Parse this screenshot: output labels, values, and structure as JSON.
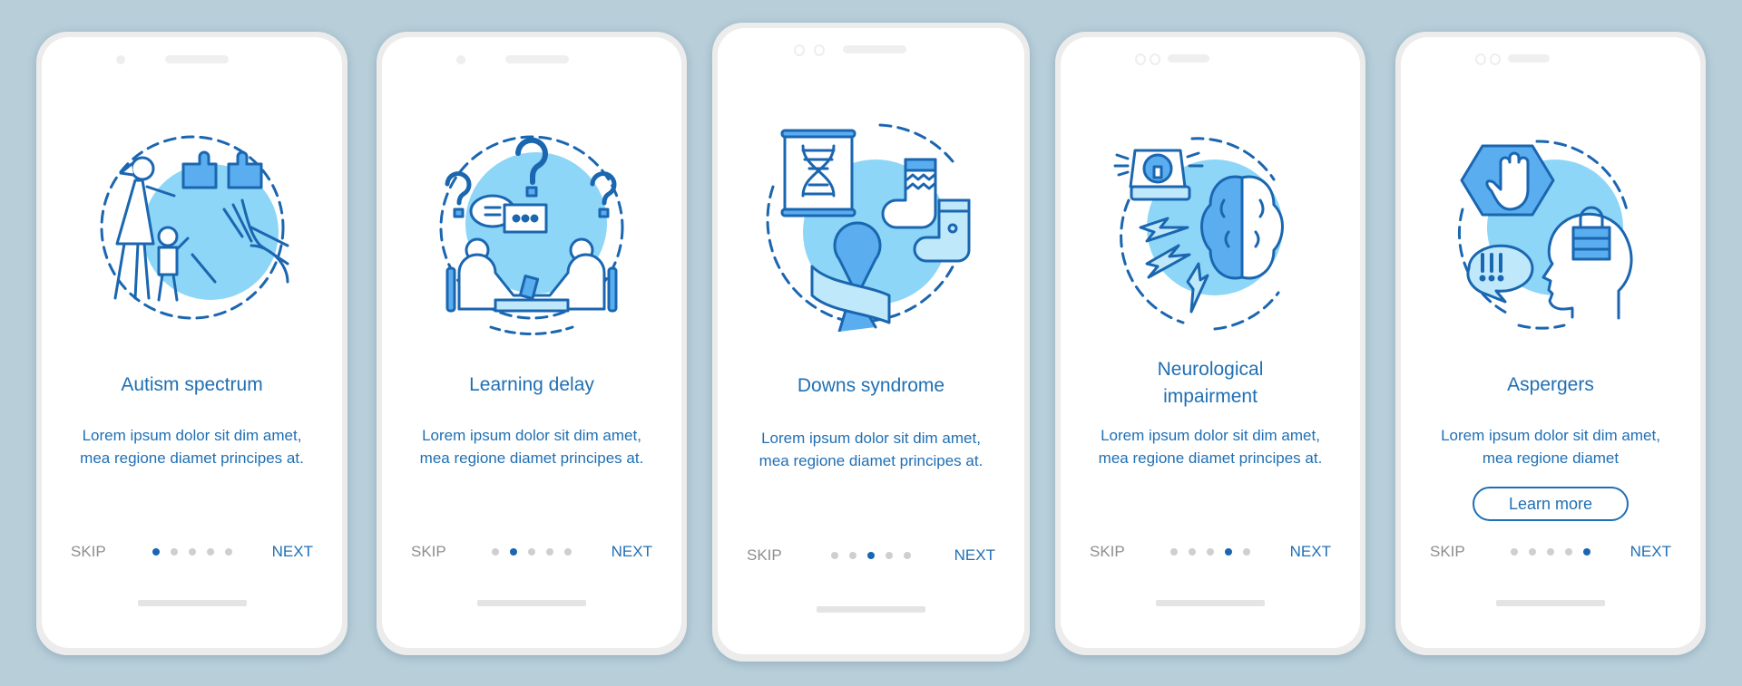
{
  "colors": {
    "background": "#b8cfda",
    "accent": "#1f6fb4",
    "active_dot": "#1a66b0",
    "inactive_dot": "#cfcfcf",
    "skip_text": "#8e8e8e",
    "illustration_fill": "#8dd6f7",
    "illustration_stroke": "#1a66b0"
  },
  "screens": [
    {
      "icon": "autism-family-icon",
      "title": "Autism spectrum",
      "description": "Lorem ipsum dolor sit dim amet, mea regione diamet principes at.",
      "skip_label": "SKIP",
      "next_label": "NEXT",
      "active_page": 1,
      "total_pages": 5
    },
    {
      "icon": "learning-conversation-icon",
      "title": "Learning delay",
      "description": "Lorem ipsum dolor sit dim amet, mea regione diamet principes at.",
      "skip_label": "SKIP",
      "next_label": "NEXT",
      "active_page": 2,
      "total_pages": 5
    },
    {
      "icon": "dna-socks-ribbon-icon",
      "title": "Downs syndrome",
      "description": "Lorem ipsum dolor sit dim amet, mea regione diamet principes at.",
      "skip_label": "SKIP",
      "next_label": "NEXT",
      "active_page": 3,
      "total_pages": 5
    },
    {
      "icon": "siren-brain-icon",
      "title": "Neurological impairment",
      "title_lines": [
        "Neurological",
        "impairment"
      ],
      "description": "Lorem ipsum dolor sit dim amet, mea regione diamet principes at.",
      "skip_label": "SKIP",
      "next_label": "NEXT",
      "active_page": 4,
      "total_pages": 5
    },
    {
      "icon": "stop-hand-head-lock-icon",
      "title": "Aspergers",
      "description": "Lorem ipsum dolor sit dim amet, mea regione diamet",
      "button_label": "Learn more",
      "skip_label": "SKIP",
      "next_label": "NEXT",
      "active_page": 5,
      "total_pages": 5
    }
  ]
}
